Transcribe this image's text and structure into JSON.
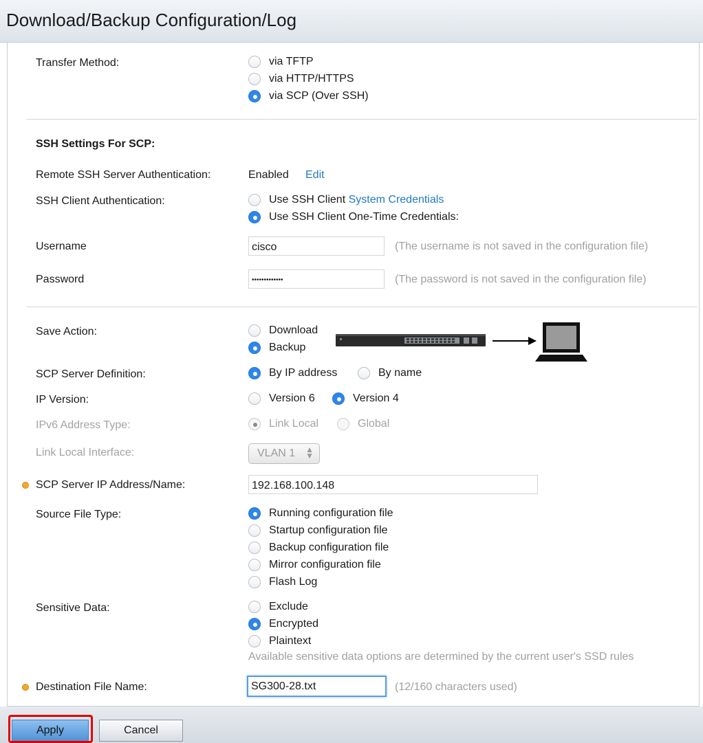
{
  "page": {
    "title": "Download/Backup Configuration/Log"
  },
  "transfer": {
    "label": "Transfer Method:",
    "options": [
      "via TFTP",
      "via HTTP/HTTPS",
      "via SCP (Over SSH)"
    ],
    "selected": 2
  },
  "ssh": {
    "section_title": "SSH Settings For SCP:",
    "remote_auth_label": "Remote SSH Server Authentication:",
    "remote_auth_value": "Enabled",
    "edit_link": "Edit",
    "client_auth_label": "SSH Client Authentication:",
    "client_option1_prefix": "Use SSH Client ",
    "client_option1_link": "System Credentials",
    "client_option2": "Use SSH Client One-Time Credentials:",
    "username_label": "Username",
    "username_value": "cisco",
    "username_note": "(The username is not saved in the configuration file)",
    "password_label": "Password",
    "password_value": "•••••••••••••",
    "password_note": "(The password is not saved in the configuration file)"
  },
  "save_action": {
    "label": "Save Action:",
    "options": [
      "Download",
      "Backup"
    ],
    "selected": 1
  },
  "server_def": {
    "label": "SCP Server Definition:",
    "options": [
      "By IP address",
      "By name"
    ],
    "selected": 0
  },
  "ip_version": {
    "label": "IP Version:",
    "options": [
      "Version 6",
      "Version 4"
    ],
    "selected": 1
  },
  "ipv6_type": {
    "label": "IPv6 Address Type:",
    "options": [
      "Link Local",
      "Global"
    ],
    "selected": 0
  },
  "link_local": {
    "label": "Link Local Interface:",
    "value": "VLAN 1"
  },
  "server_ip": {
    "label": "SCP Server IP Address/Name:",
    "value": "192.168.100.148"
  },
  "source_type": {
    "label": "Source File Type:",
    "options": [
      "Running configuration file",
      "Startup configuration file",
      "Backup configuration file",
      "Mirror configuration file",
      "Flash Log"
    ],
    "selected": 0
  },
  "sensitive": {
    "label": "Sensitive Data:",
    "options": [
      "Exclude",
      "Encrypted",
      "Plaintext"
    ],
    "selected": 1,
    "note": "Available sensitive data options are determined by the current user's SSD rules"
  },
  "dest_file": {
    "label": "Destination File Name:",
    "value": "SG300-28.txt",
    "note": "(12/160 characters used)"
  },
  "buttons": {
    "apply": "Apply",
    "cancel": "Cancel"
  },
  "colors": {
    "accent": "#2f86ea",
    "link": "#1f7ac4",
    "required": "#f0a830",
    "highlight": "#e00000"
  }
}
